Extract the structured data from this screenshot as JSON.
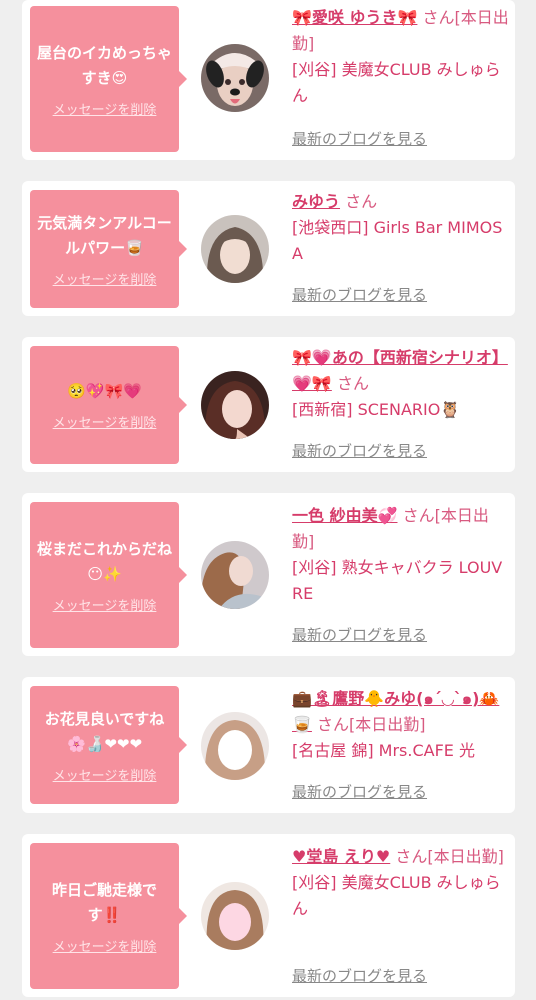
{
  "entries": [
    {
      "message": "屋台のイカめっちゃすき😍",
      "delete_label": "メッセージを削除",
      "name": "🎀愛咲 ゆうき🎀",
      "suffix": "さん",
      "status": "[本日出勤]",
      "shop": "[刈谷] 美魔女CLUB みしゅらん",
      "blog_label": "最新のブログを見る",
      "avatar_icon": "avatar-dog-filter-photo"
    },
    {
      "message": "元気満タンアルコールパワー🥃",
      "delete_label": "メッセージを削除",
      "name": "みゆう",
      "suffix": "さん",
      "status": "",
      "shop": "[池袋西口] Girls Bar MIMOSA",
      "blog_label": "最新のブログを見る",
      "avatar_icon": "avatar-photo"
    },
    {
      "message": "🥺💖🎀💗",
      "delete_label": "メッセージを削除",
      "name": "🎀💗あの【西新宿シナリオ】💗🎀",
      "suffix": "さん",
      "status": "",
      "shop": "[西新宿] SCENARIO🦉",
      "blog_label": "最新のブログを見る",
      "avatar_icon": "avatar-photo"
    },
    {
      "message": "桜まだこれからだね😶✨",
      "delete_label": "メッセージを削除",
      "name": "一色 紗由美💞",
      "suffix": "さん",
      "status": "[本日出勤]",
      "shop": "[刈谷] 熟女キャバクラ LOUVRE",
      "blog_label": "最新のブログを見る",
      "avatar_icon": "avatar-photo"
    },
    {
      "message": "お花見良いですね🌸🍶❤❤❤",
      "delete_label": "メッセージを削除",
      "name": "💼🏝鷹野🐥みゆ(๑´◡`๑)🦀🥃",
      "suffix": "さん",
      "status": "[本日出勤]",
      "shop": "[名古屋 錦] Mrs.CAFE 光",
      "blog_label": "最新のブログを見る",
      "avatar_icon": "avatar-photo-blurred"
    },
    {
      "message": "昨日ご馳走様です‼️",
      "delete_label": "メッセージを削除",
      "name": "♥堂島 えり♥",
      "suffix": "さん",
      "status": "[本日出勤]",
      "shop": "[刈谷] 美魔女CLUB みしゅらん",
      "blog_label": "最新のブログを見る",
      "avatar_icon": "avatar-photo-blurred"
    }
  ],
  "colors": {
    "bubble": "#f5909d",
    "name": "#d63c6a",
    "link_gray": "#888888",
    "background": "#efefef"
  }
}
